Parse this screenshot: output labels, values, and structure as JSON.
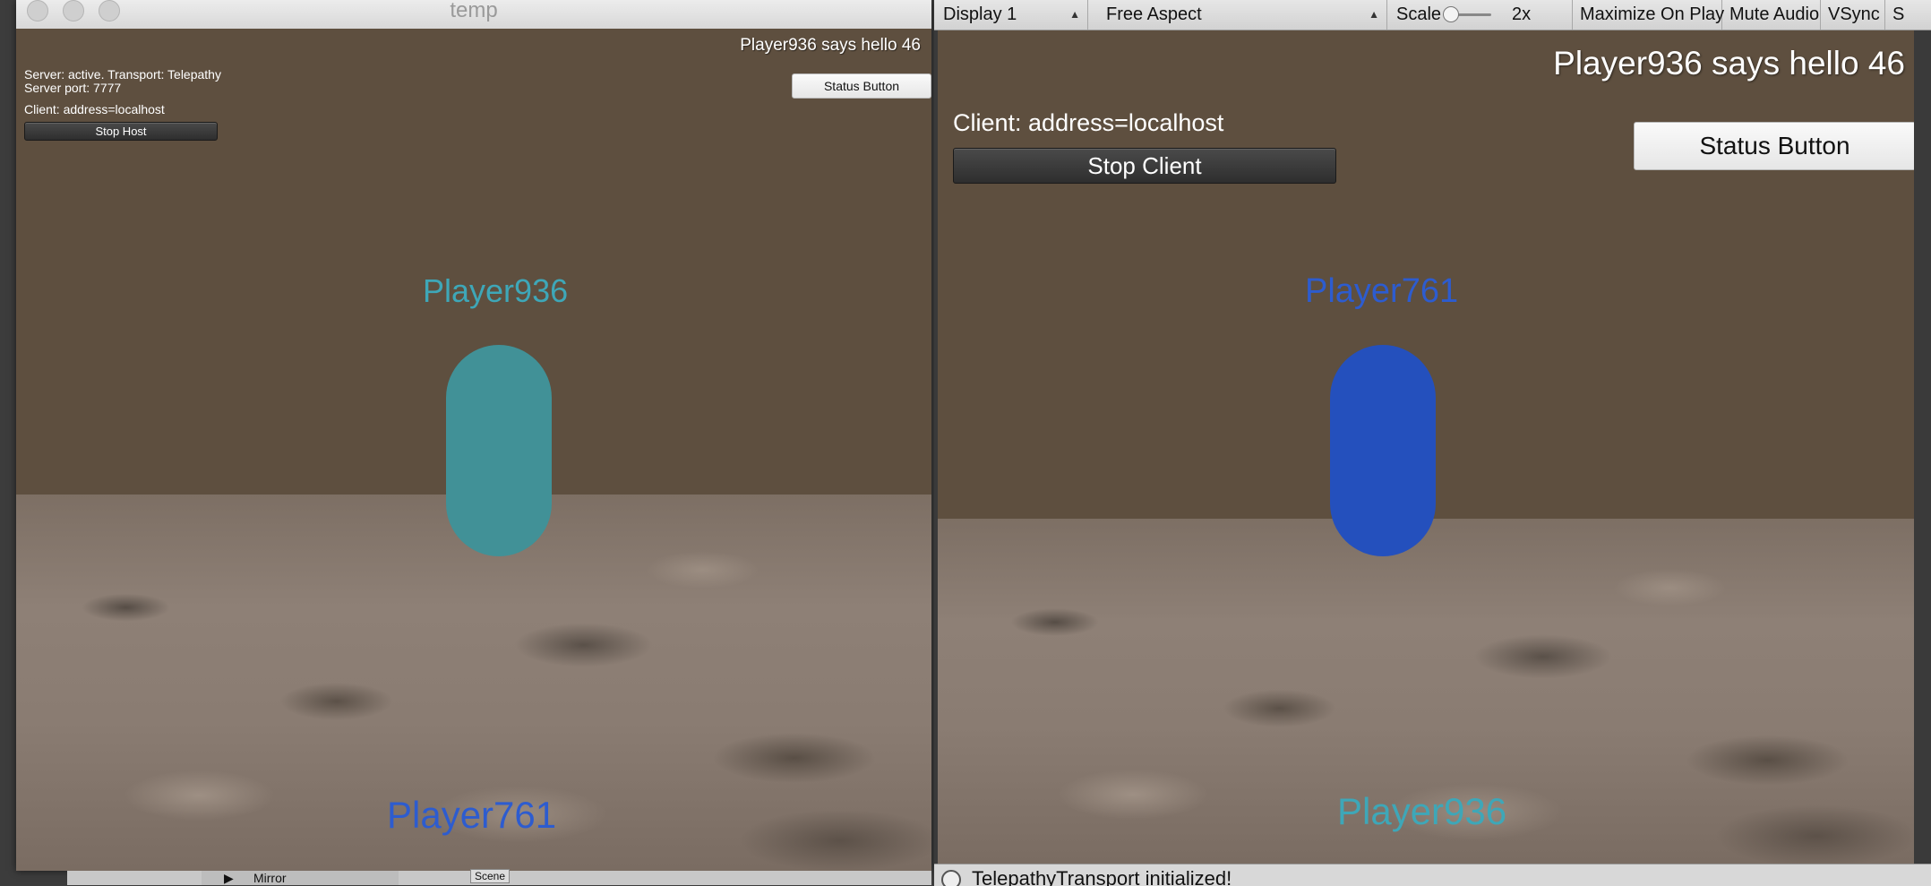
{
  "left_window": {
    "title": "temp",
    "hud": {
      "server_status": "Server: active. Transport: Telepathy",
      "server_port": "Server port: 7777",
      "client_address": "Client: address=localhost",
      "stop_button": "Stop Host",
      "message": "Player936 says hello 46",
      "status_button": "Status Button"
    },
    "players": {
      "near_name": "Player936",
      "near_color": "#419197",
      "far_name": "Player761",
      "far_color": "#2d5ccf"
    }
  },
  "right_window": {
    "toolbar": {
      "display": "Display 1",
      "aspect": "Free Aspect",
      "scale_label": "Scale",
      "scale_value": "2x",
      "maximize": "Maximize On Play",
      "mute": "Mute Audio",
      "vsync": "VSync",
      "cut_off": "S"
    },
    "hud": {
      "client_address": "Client: address=localhost",
      "stop_button": "Stop Client",
      "message": "Player936 says hello 46",
      "status_button": "Status Button"
    },
    "players": {
      "near_name": "Player761",
      "near_color": "#2450bd",
      "far_name": "Player936",
      "far_color": "#3ea7b8"
    },
    "console_message": "TelepathyTransport initialized!"
  },
  "editor_strip": {
    "hierarchy_item": "Mirror",
    "scene_label": "Scene"
  }
}
